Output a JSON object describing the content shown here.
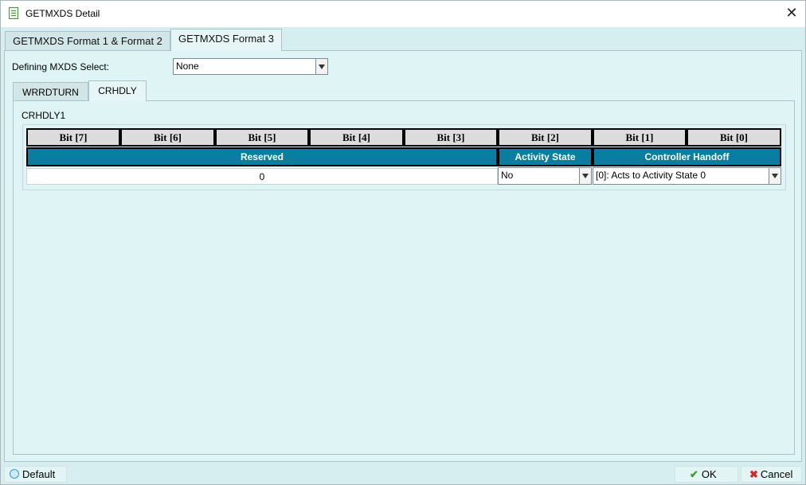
{
  "window": {
    "title": "GETMXDS Detail",
    "close_symbol": "✕"
  },
  "outer_tabs": [
    {
      "label": "GETMXDS Format 1 & Format 2",
      "active": false
    },
    {
      "label": "GETMXDS Format 3",
      "active": true
    }
  ],
  "mxds_select": {
    "label": "Defining MXDS Select:",
    "value": "None"
  },
  "inner_tabs": [
    {
      "label": "WRRDTURN",
      "active": false
    },
    {
      "label": "CRHDLY",
      "active": true
    }
  ],
  "register": {
    "name": "CRHDLY1",
    "bits": [
      "Bit [7]",
      "Bit [6]",
      "Bit [5]",
      "Bit [4]",
      "Bit [3]",
      "Bit [2]",
      "Bit [1]",
      "Bit [0]"
    ],
    "fields": [
      {
        "name": "Reserved",
        "bits": "7:3",
        "value": "0"
      },
      {
        "name": "Activity State",
        "bits": "2",
        "value": "No"
      },
      {
        "name": "Controller Handoff",
        "bits": "1:0",
        "value": "[0]: Acts to Activity State 0"
      }
    ]
  },
  "colors": {
    "field_header_bg": "#0a7ea0",
    "window_bg": "#d6eef0"
  },
  "footer": {
    "default_label": "Default",
    "ok_label": "OK",
    "cancel_label": "Cancel"
  }
}
